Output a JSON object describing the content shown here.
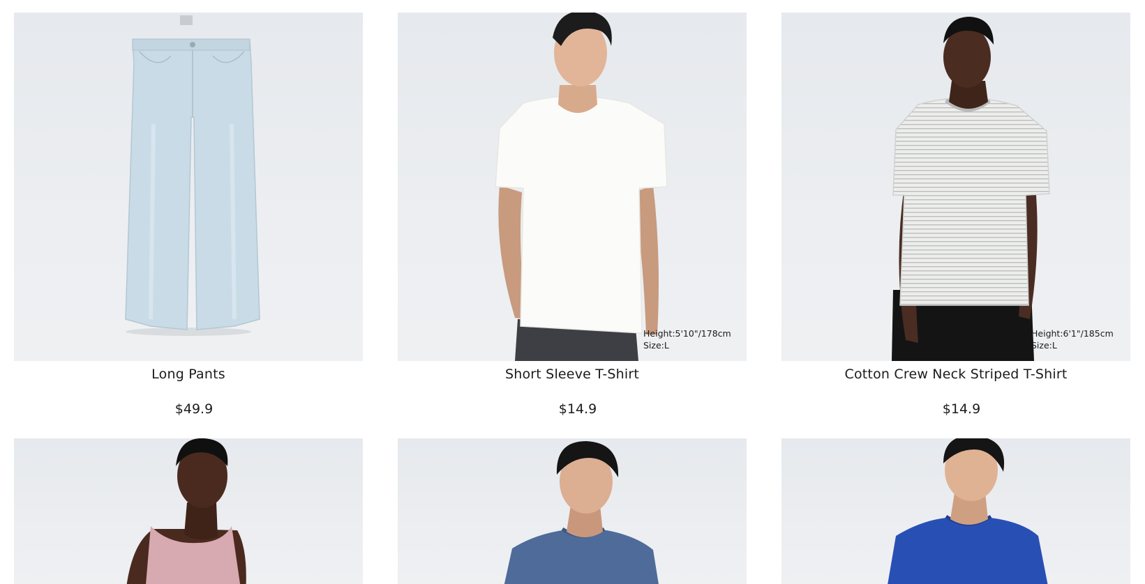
{
  "products": [
    {
      "name": "Long Pants",
      "price": "$49.9",
      "image_icon": "light-denim-jeans-image"
    },
    {
      "name": "Short Sleeve T-Shirt",
      "price": "$14.9",
      "image_icon": "model-white-tshirt-image",
      "model_height": "Height:5'10\"/178cm",
      "model_size": "Size:L"
    },
    {
      "name": "Cotton Crew Neck Striped T-Shirt",
      "price": "$14.9",
      "image_icon": "model-striped-tshirt-image",
      "model_height": "Height:6'1\"/185cm",
      "model_size": "Size:L"
    },
    {
      "image_icon": "model-pink-tank-image"
    },
    {
      "image_icon": "model-slate-blue-tshirt-image"
    },
    {
      "image_icon": "model-royal-blue-tshirt-image"
    }
  ],
  "colors": {
    "background": "#ffffff",
    "image_bg": "#e9ecef",
    "text": "#1b1b1b",
    "denim": "#c9dbe6",
    "white_tee": "#fbfbf9",
    "striped_tee": "#e3e3e1",
    "pink_tank": "#d7a9b0",
    "slate_blue_tee": "#4e6b9a",
    "royal_blue_tee": "#2850b4"
  }
}
